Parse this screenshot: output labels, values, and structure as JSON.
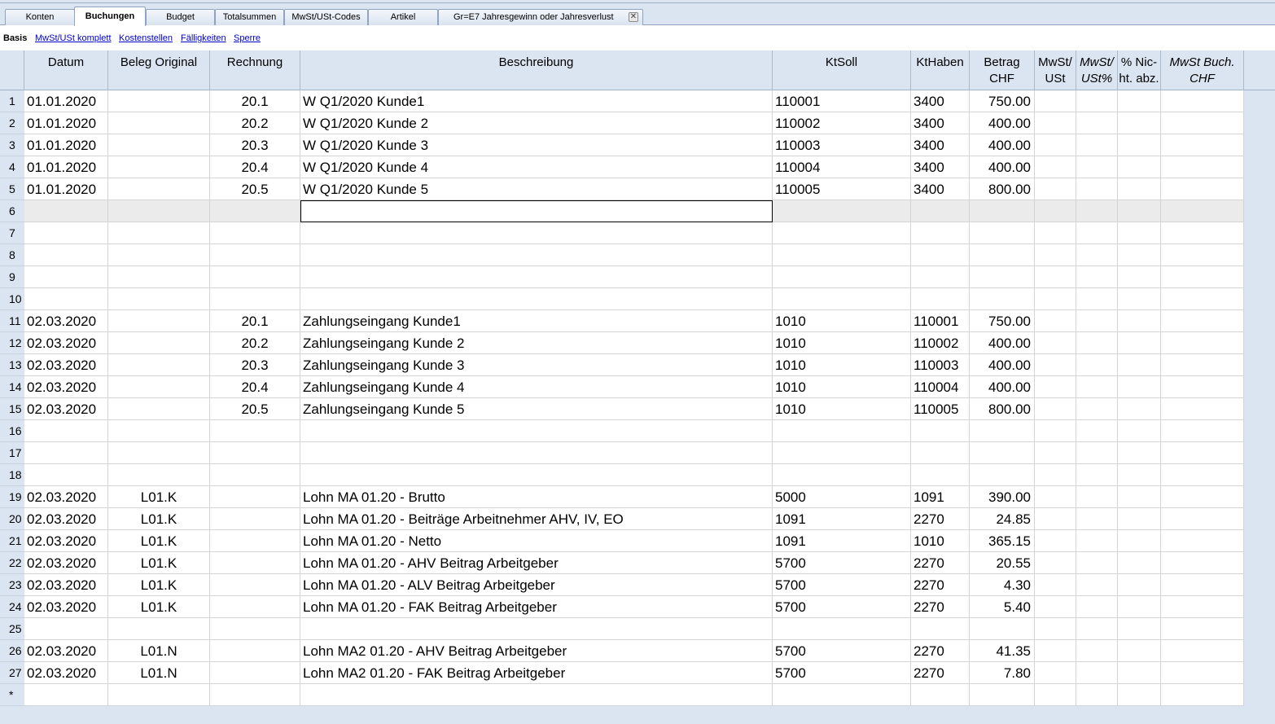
{
  "tabs": [
    {
      "label": "Konten"
    },
    {
      "label": "Buchungen"
    },
    {
      "label": "Budget"
    },
    {
      "label": "Totalsummen"
    },
    {
      "label": "MwSt/USt-Codes"
    },
    {
      "label": "Artikel"
    },
    {
      "label": "Gr=E7 Jahresgewinn oder Jahresverlust"
    }
  ],
  "active_tab": "Buchungen",
  "views": [
    {
      "label": "Basis"
    },
    {
      "label": "MwSt/USt komplett"
    },
    {
      "label": "Kostenstellen"
    },
    {
      "label": "Fälligkeiten"
    },
    {
      "label": "Sperre"
    }
  ],
  "columns": {
    "datum": "Datum",
    "beleg": "Beleg Original",
    "rechnung": "Rechnung",
    "beschreibung": "Beschreibung",
    "ktsoll": "KtSoll",
    "kthaben": "KtHaben",
    "betrag": "Betrag CHF",
    "mwst1": "MwSt/",
    "mwst2": "USt",
    "mwstp1": "MwSt/",
    "mwstp2": "USt%",
    "nicht1": "% Nic-",
    "nicht2": "ht. abz.",
    "buch1": "MwSt Buch.",
    "buch2": "CHF"
  },
  "rows": [
    {
      "n": "1",
      "datum": "01.01.2020",
      "beleg": "",
      "rechnung": "20.1",
      "beschreibung": "W Q1/2020 Kunde1",
      "ktsoll": "110001",
      "kthaben": "3400",
      "betrag": "750.00"
    },
    {
      "n": "2",
      "datum": "01.01.2020",
      "beleg": "",
      "rechnung": "20.2",
      "beschreibung": "W Q1/2020 Kunde 2",
      "ktsoll": "110002",
      "kthaben": "3400",
      "betrag": "400.00"
    },
    {
      "n": "3",
      "datum": "01.01.2020",
      "beleg": "",
      "rechnung": "20.3",
      "beschreibung": "W Q1/2020 Kunde 3",
      "ktsoll": "110003",
      "kthaben": "3400",
      "betrag": "400.00"
    },
    {
      "n": "4",
      "datum": "01.01.2020",
      "beleg": "",
      "rechnung": "20.4",
      "beschreibung": "W Q1/2020 Kunde 4",
      "ktsoll": "110004",
      "kthaben": "3400",
      "betrag": "400.00"
    },
    {
      "n": "5",
      "datum": "01.01.2020",
      "beleg": "",
      "rechnung": "20.5",
      "beschreibung": "W Q1/2020 Kunde 5",
      "ktsoll": "110005",
      "kthaben": "3400",
      "betrag": "800.00"
    },
    {
      "n": "6",
      "datum": "",
      "beleg": "",
      "rechnung": "",
      "beschreibung": "",
      "ktsoll": "",
      "kthaben": "",
      "betrag": "",
      "selected": true
    },
    {
      "n": "7",
      "datum": "",
      "beleg": "",
      "rechnung": "",
      "beschreibung": "",
      "ktsoll": "",
      "kthaben": "",
      "betrag": ""
    },
    {
      "n": "8",
      "datum": "",
      "beleg": "",
      "rechnung": "",
      "beschreibung": "",
      "ktsoll": "",
      "kthaben": "",
      "betrag": ""
    },
    {
      "n": "9",
      "datum": "",
      "beleg": "",
      "rechnung": "",
      "beschreibung": "",
      "ktsoll": "",
      "kthaben": "",
      "betrag": ""
    },
    {
      "n": "10",
      "datum": "",
      "beleg": "",
      "rechnung": "",
      "beschreibung": "",
      "ktsoll": "",
      "kthaben": "",
      "betrag": ""
    },
    {
      "n": "11",
      "datum": "02.03.2020",
      "beleg": "",
      "rechnung": "20.1",
      "beschreibung": "Zahlungseingang Kunde1",
      "ktsoll": "1010",
      "kthaben": "110001",
      "betrag": "750.00"
    },
    {
      "n": "12",
      "datum": "02.03.2020",
      "beleg": "",
      "rechnung": "20.2",
      "beschreibung": "Zahlungseingang Kunde 2",
      "ktsoll": "1010",
      "kthaben": "110002",
      "betrag": "400.00"
    },
    {
      "n": "13",
      "datum": "02.03.2020",
      "beleg": "",
      "rechnung": "20.3",
      "beschreibung": "Zahlungseingang Kunde 3",
      "ktsoll": "1010",
      "kthaben": "110003",
      "betrag": "400.00"
    },
    {
      "n": "14",
      "datum": "02.03.2020",
      "beleg": "",
      "rechnung": "20.4",
      "beschreibung": "Zahlungseingang Kunde 4",
      "ktsoll": "1010",
      "kthaben": "110004",
      "betrag": "400.00"
    },
    {
      "n": "15",
      "datum": "02.03.2020",
      "beleg": "",
      "rechnung": "20.5",
      "beschreibung": "Zahlungseingang Kunde 5",
      "ktsoll": "1010",
      "kthaben": "110005",
      "betrag": "800.00"
    },
    {
      "n": "16",
      "datum": "",
      "beleg": "",
      "rechnung": "",
      "beschreibung": "",
      "ktsoll": "",
      "kthaben": "",
      "betrag": ""
    },
    {
      "n": "17",
      "datum": "",
      "beleg": "",
      "rechnung": "",
      "beschreibung": "",
      "ktsoll": "",
      "kthaben": "",
      "betrag": ""
    },
    {
      "n": "18",
      "datum": "",
      "beleg": "",
      "rechnung": "",
      "beschreibung": "",
      "ktsoll": "",
      "kthaben": "",
      "betrag": ""
    },
    {
      "n": "19",
      "datum": "02.03.2020",
      "beleg": "L01.K",
      "rechnung": "",
      "beschreibung": "Lohn MA 01.20 - Brutto",
      "ktsoll": "5000",
      "kthaben": "1091",
      "betrag": "390.00"
    },
    {
      "n": "20",
      "datum": "02.03.2020",
      "beleg": "L01.K",
      "rechnung": "",
      "beschreibung": "Lohn MA 01.20 - Beiträge Arbeitnehmer AHV, IV, EO",
      "ktsoll": "1091",
      "kthaben": "2270",
      "betrag": "24.85"
    },
    {
      "n": "21",
      "datum": "02.03.2020",
      "beleg": "L01.K",
      "rechnung": "",
      "beschreibung": "Lohn MA 01.20 - Netto",
      "ktsoll": "1091",
      "kthaben": "1010",
      "betrag": "365.15"
    },
    {
      "n": "22",
      "datum": "02.03.2020",
      "beleg": "L01.K",
      "rechnung": "",
      "beschreibung": "Lohn MA 01.20 - AHV Beitrag Arbeitgeber",
      "ktsoll": "5700",
      "kthaben": "2270",
      "betrag": "20.55"
    },
    {
      "n": "23",
      "datum": "02.03.2020",
      "beleg": "L01.K",
      "rechnung": "",
      "beschreibung": "Lohn MA 01.20 - ALV Beitrag Arbeitgeber",
      "ktsoll": "5700",
      "kthaben": "2270",
      "betrag": "4.30"
    },
    {
      "n": "24",
      "datum": "02.03.2020",
      "beleg": "L01.K",
      "rechnung": "",
      "beschreibung": "Lohn MA 01.20 - FAK Beitrag Arbeitgeber",
      "ktsoll": "5700",
      "kthaben": "2270",
      "betrag": "5.40"
    },
    {
      "n": "25",
      "datum": "",
      "beleg": "",
      "rechnung": "",
      "beschreibung": "",
      "ktsoll": "",
      "kthaben": "",
      "betrag": ""
    },
    {
      "n": "26",
      "datum": "02.03.2020",
      "beleg": "L01.N",
      "rechnung": "",
      "beschreibung": "Lohn MA2 01.20 - AHV Beitrag Arbeitgeber",
      "ktsoll": "5700",
      "kthaben": "2270",
      "betrag": "41.35"
    },
    {
      "n": "27",
      "datum": "02.03.2020",
      "beleg": "L01.N",
      "rechnung": "",
      "beschreibung": "Lohn MA2 01.20 - FAK Beitrag Arbeitgeber",
      "ktsoll": "5700",
      "kthaben": "2270",
      "betrag": "7.80"
    },
    {
      "n": "*",
      "datum": "",
      "beleg": "",
      "rechnung": "",
      "beschreibung": "",
      "ktsoll": "",
      "kthaben": "",
      "betrag": ""
    }
  ],
  "icons": {
    "tab_close": "close-icon"
  }
}
